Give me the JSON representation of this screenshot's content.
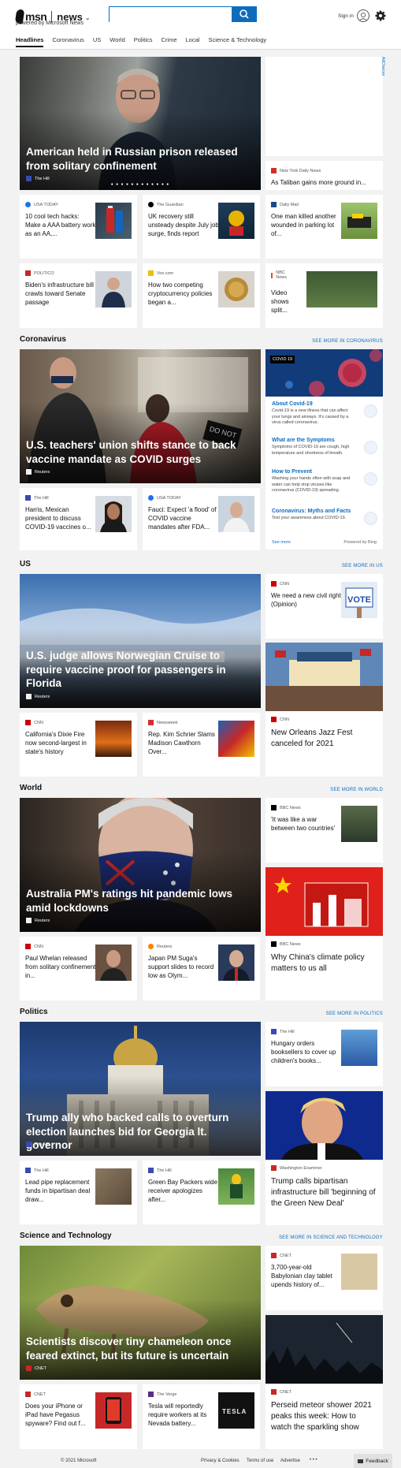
{
  "header": {
    "brand": "msn",
    "section": "news",
    "powered": "powered by Microsoft News",
    "search_value": "",
    "signin": "Sign in"
  },
  "nav": [
    "Headlines",
    "Coronavirus",
    "US",
    "World",
    "Politics",
    "Crime",
    "Local",
    "Science & Technology"
  ],
  "ad_label": "AdChoices",
  "top": {
    "hero": {
      "title": "American held in Russian prison released from solitary confinement",
      "source": "The Hill",
      "carousel_dots": "● ● ● ● ● ● ● ● ● ● ● ●"
    },
    "side": {
      "source": "New York Daily News",
      "title": "As Taliban gains more ground in..."
    },
    "cards": [
      {
        "source": "USA TODAY",
        "title": "10 cool tech hacks: Make a AAA battery work as an AA,..."
      },
      {
        "source": "The Guardian",
        "title": "UK recovery still unsteady despite July job surge, finds report"
      },
      {
        "source": "Daily Mail",
        "title": "One man killed another wounded in parking lot of..."
      },
      {
        "source": "POLITICO",
        "title": "Biden's infrastructure bill crawls toward Senate passage"
      },
      {
        "source": "Vox.com",
        "title": "How two competing cryptocurrency policies began a..."
      },
      {
        "source": "NBC News",
        "title": "Video shows split..."
      }
    ]
  },
  "coronavirus": {
    "title": "Coronavirus",
    "more": "SEE MORE IN CORONAVIRUS",
    "hero": {
      "title": "U.S. teachers' union shifts stance to back vaccine mandate as COVID surges",
      "source": "Reuters"
    },
    "cards": [
      {
        "source": "The Hill",
        "title": "Harris, Mexican president to discuss COVID-19 vaccines o..."
      },
      {
        "source": "USA TODAY",
        "title": "Fauci: Expect 'a flood' of COVID vaccine mandates after FDA..."
      }
    ],
    "module": {
      "badge": "COVID 19",
      "items": [
        {
          "title": "About Covid-19",
          "desc": "Covid-19 is a new illness that can affect your lungs and airways. It's caused by a virus called coronavirus."
        },
        {
          "title": "What are the Symptoms",
          "desc": "Symptoms of COVID-19 are cough, high temperature and shortness of breath."
        },
        {
          "title": "How to Prevent",
          "desc": "Washing your hands often with soap and water can help stop viruses like coronavirus (COVID-19) spreading."
        },
        {
          "title": "Coronavirus: Myths and Facts",
          "desc": "Test your awareness about COVID-19."
        }
      ],
      "see_more": "See more",
      "powered": "Powered by Bing"
    }
  },
  "us": {
    "title": "US",
    "more": "SEE MORE IN US",
    "hero": {
      "title": "U.S. judge allows Norwegian Cruise to require vaccine proof for passengers in Florida",
      "source": "Reuters"
    },
    "side1": {
      "source": "CNN",
      "title": "We need a new civil right (Opinion)",
      "thumb_text": "VOTE"
    },
    "side2": {
      "source": "CNN",
      "title": "New Orleans Jazz Fest canceled for 2021"
    },
    "cards": [
      {
        "source": "CNN",
        "title": "California's Dixie Fire now second-largest in state's history"
      },
      {
        "source": "Newsweek",
        "title": "Rep. Kim Schrier Slams Madison Cawthorn Over..."
      }
    ]
  },
  "world": {
    "title": "World",
    "more": "SEE MORE IN WORLD",
    "hero": {
      "title": "Australia PM's ratings hit pandemic lows amid lockdowns",
      "source": "Reuters"
    },
    "side1": {
      "source": "BBC News",
      "title": "'It was like a war between two countries'"
    },
    "side2": {
      "source": "BBC News",
      "title": "Why China's climate policy matters to us all"
    },
    "cards": [
      {
        "source": "CNN",
        "title": "Paul Whelan released from solitary confinement in..."
      },
      {
        "source": "Reuters",
        "title": "Japan PM Suga's support slides to record low as Olym..."
      }
    ]
  },
  "politics": {
    "title": "Politics",
    "more": "SEE MORE IN POLITICS",
    "hero": {
      "title": "Trump ally who backed calls to overturn election launches bid for Georgia lt. governor",
      "source": "The Hill"
    },
    "side1": {
      "source": "The Hill",
      "title": "Hungary orders booksellers to cover up children's books..."
    },
    "side2": {
      "source": "Washington Examiner",
      "title": "Trump calls bipartisan infrastructure bill 'beginning of the Green New Deal'"
    },
    "cards": [
      {
        "source": "The Hill",
        "title": "Lead pipe replacement funds in bipartisan deal draw..."
      },
      {
        "source": "The Hill",
        "title": "Green Bay Packers wide receiver apologizes after..."
      }
    ]
  },
  "scitech": {
    "title": "Science and Technology",
    "more": "SEE MORE IN SCIENCE AND TECHNOLOGY",
    "hero": {
      "title": "Scientists discover tiny chameleon once feared extinct, but its future is uncertain",
      "source": "CNET"
    },
    "side1": {
      "source": "CNET",
      "title": "3,700-year-old Babylonian clay tablet upends history of..."
    },
    "side2": {
      "source": "CNET",
      "title": "Perseid meteor shower 2021 peaks this week: How to watch the sparkling show"
    },
    "cards": [
      {
        "source": "CNET",
        "title": "Does your iPhone or iPad have Pegasus spyware? Find out f..."
      },
      {
        "source": "The Verge",
        "title": "Tesla will reportedly require workers at its Nevada battery..."
      }
    ],
    "tesla_text": "TESLA"
  },
  "footer": {
    "copyright": "© 2021 Microsoft",
    "links": [
      "Privacy & Cookies",
      "Terms of use",
      "Advertise"
    ],
    "more": "• • •",
    "feedback": "Feedback"
  }
}
